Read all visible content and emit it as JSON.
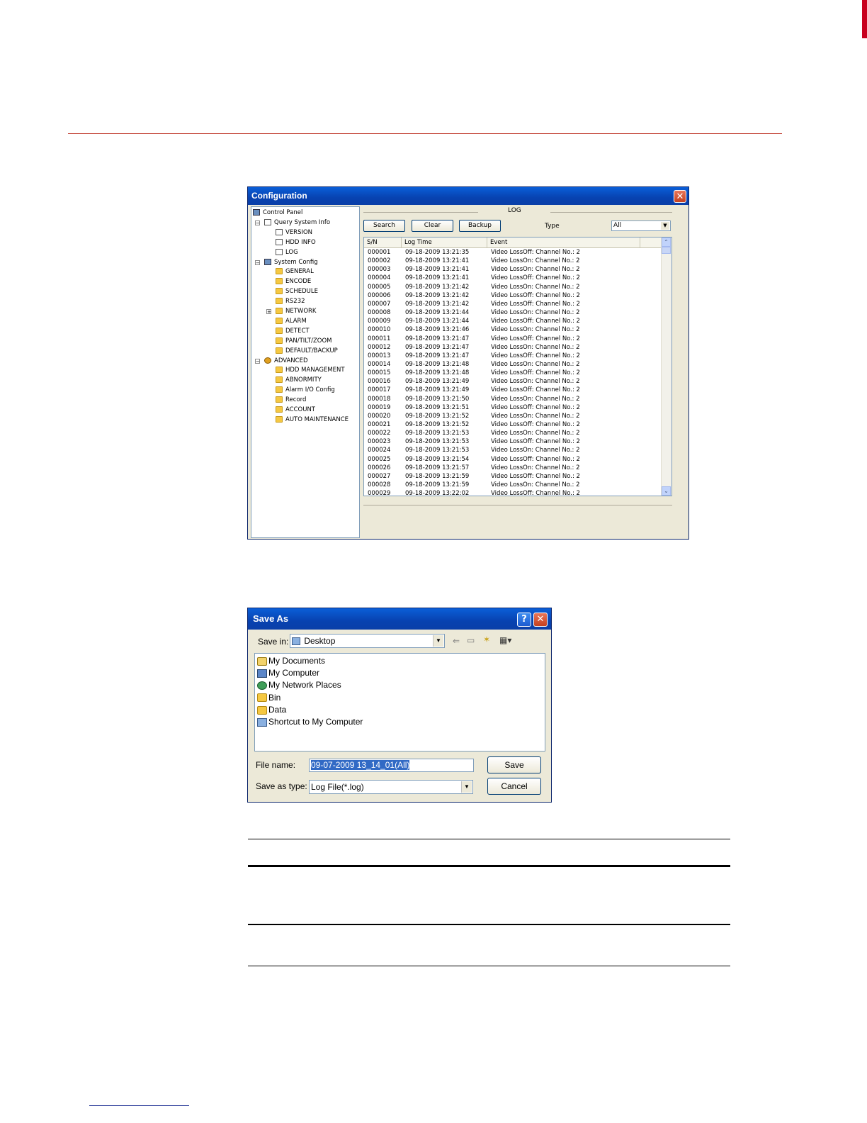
{
  "config_window": {
    "title": "Configuration",
    "close_glyph": "✕",
    "tree": [
      {
        "label": "Control Panel",
        "icon": "computer-icon",
        "level": 0,
        "expander": ""
      },
      {
        "label": "Query System Info",
        "icon": "document-icon",
        "level": 1,
        "expander": "−"
      },
      {
        "label": "VERSION",
        "icon": "document-icon",
        "level": 2,
        "expander": ""
      },
      {
        "label": "HDD INFO",
        "icon": "document-icon",
        "level": 2,
        "expander": ""
      },
      {
        "label": "LOG",
        "icon": "document-icon",
        "level": 2,
        "expander": ""
      },
      {
        "label": "System Config",
        "icon": "tools-icon",
        "level": 1,
        "expander": "−"
      },
      {
        "label": "GENERAL",
        "icon": "folder-icon",
        "level": 2,
        "expander": ""
      },
      {
        "label": "ENCODE",
        "icon": "folder-icon",
        "level": 2,
        "expander": ""
      },
      {
        "label": "SCHEDULE",
        "icon": "folder-icon",
        "level": 2,
        "expander": ""
      },
      {
        "label": "RS232",
        "icon": "folder-icon",
        "level": 2,
        "expander": ""
      },
      {
        "label": "NETWORK",
        "icon": "folder-icon",
        "level": 2,
        "expander": "+"
      },
      {
        "label": "ALARM",
        "icon": "folder-icon",
        "level": 2,
        "expander": ""
      },
      {
        "label": "DETECT",
        "icon": "folder-icon",
        "level": 2,
        "expander": ""
      },
      {
        "label": "PAN/TILT/ZOOM",
        "icon": "folder-icon",
        "level": 2,
        "expander": ""
      },
      {
        "label": "DEFAULT/BACKUP",
        "icon": "folder-icon",
        "level": 2,
        "expander": ""
      },
      {
        "label": "ADVANCED",
        "icon": "gear-icon",
        "level": 1,
        "expander": "−"
      },
      {
        "label": "HDD MANAGEMENT",
        "icon": "folder-icon",
        "level": 2,
        "expander": ""
      },
      {
        "label": "ABNORMITY",
        "icon": "folder-icon",
        "level": 2,
        "expander": ""
      },
      {
        "label": "Alarm I/O Config",
        "icon": "folder-icon",
        "level": 2,
        "expander": ""
      },
      {
        "label": "Record",
        "icon": "folder-icon",
        "level": 2,
        "expander": ""
      },
      {
        "label": "ACCOUNT",
        "icon": "folder-icon",
        "level": 2,
        "expander": ""
      },
      {
        "label": "AUTO MAINTENANCE",
        "icon": "folder-icon",
        "level": 2,
        "expander": ""
      }
    ],
    "log": {
      "group_label": "LOG",
      "search_label": "Search",
      "clear_label": "Clear",
      "backup_label": "Backup",
      "type_label": "Type",
      "type_value": "All",
      "columns": [
        "S/N",
        "Log Time",
        "Event"
      ],
      "rows": [
        [
          "000001",
          "09-18-2009 13:21:35",
          "Video LossOff: Channel No.: 2"
        ],
        [
          "000002",
          "09-18-2009 13:21:41",
          "Video LossOn: Channel No.: 2"
        ],
        [
          "000003",
          "09-18-2009 13:21:41",
          "Video LossOn: Channel No.: 2"
        ],
        [
          "000004",
          "09-18-2009 13:21:41",
          "Video LossOff: Channel No.: 2"
        ],
        [
          "000005",
          "09-18-2009 13:21:42",
          "Video LossOn: Channel No.: 2"
        ],
        [
          "000006",
          "09-18-2009 13:21:42",
          "Video LossOff: Channel No.: 2"
        ],
        [
          "000007",
          "09-18-2009 13:21:42",
          "Video LossOff: Channel No.: 2"
        ],
        [
          "000008",
          "09-18-2009 13:21:44",
          "Video LossOn: Channel No.: 2"
        ],
        [
          "000009",
          "09-18-2009 13:21:44",
          "Video LossOff: Channel No.: 2"
        ],
        [
          "000010",
          "09-18-2009 13:21:46",
          "Video LossOn: Channel No.: 2"
        ],
        [
          "000011",
          "09-18-2009 13:21:47",
          "Video LossOff: Channel No.: 2"
        ],
        [
          "000012",
          "09-18-2009 13:21:47",
          "Video LossOn: Channel No.: 2"
        ],
        [
          "000013",
          "09-18-2009 13:21:47",
          "Video LossOff: Channel No.: 2"
        ],
        [
          "000014",
          "09-18-2009 13:21:48",
          "Video LossOn: Channel No.: 2"
        ],
        [
          "000015",
          "09-18-2009 13:21:48",
          "Video LossOff: Channel No.: 2"
        ],
        [
          "000016",
          "09-18-2009 13:21:49",
          "Video LossOn: Channel No.: 2"
        ],
        [
          "000017",
          "09-18-2009 13:21:49",
          "Video LossOff: Channel No.: 2"
        ],
        [
          "000018",
          "09-18-2009 13:21:50",
          "Video LossOn: Channel No.: 2"
        ],
        [
          "000019",
          "09-18-2009 13:21:51",
          "Video LossOff: Channel No.: 2"
        ],
        [
          "000020",
          "09-18-2009 13:21:52",
          "Video LossOn: Channel No.: 2"
        ],
        [
          "000021",
          "09-18-2009 13:21:52",
          "Video LossOff: Channel No.: 2"
        ],
        [
          "000022",
          "09-18-2009 13:21:53",
          "Video LossOn: Channel No.: 2"
        ],
        [
          "000023",
          "09-18-2009 13:21:53",
          "Video LossOff: Channel No.: 2"
        ],
        [
          "000024",
          "09-18-2009 13:21:53",
          "Video LossOn: Channel No.: 2"
        ],
        [
          "000025",
          "09-18-2009 13:21:54",
          "Video LossOff: Channel No.: 2"
        ],
        [
          "000026",
          "09-18-2009 13:21:57",
          "Video LossOn: Channel No.: 2"
        ],
        [
          "000027",
          "09-18-2009 13:21:59",
          "Video LossOff: Channel No.: 2"
        ],
        [
          "000028",
          "09-18-2009 13:21:59",
          "Video LossOn: Channel No.: 2"
        ],
        [
          "000029",
          "09-18-2009 13:22:02",
          "Video LossOff: Channel No.: 2"
        ]
      ]
    }
  },
  "save_as": {
    "title": "Save As",
    "help_glyph": "?",
    "close_glyph": "✕",
    "save_in_label": "Save in:",
    "save_in_value": "Desktop",
    "items": [
      {
        "label": "My Documents",
        "icon": "my-documents-icon"
      },
      {
        "label": "My Computer",
        "icon": "my-computer-icon"
      },
      {
        "label": "My Network Places",
        "icon": "network-places-icon"
      },
      {
        "label": "Bin",
        "icon": "folder-icon"
      },
      {
        "label": "Data",
        "icon": "folder-icon"
      },
      {
        "label": "Shortcut to My Computer",
        "icon": "shortcut-icon"
      }
    ],
    "file_name_label": "File name:",
    "file_name_value": "09-07-2009 13_14_01(All)",
    "save_as_type_label": "Save as type:",
    "save_as_type_value": "Log File(*.log)",
    "save_button": "Save",
    "cancel_button": "Cancel"
  },
  "colors": {
    "title_bar": "#0842b0",
    "accent_red": "#c0392b",
    "window_bg": "#ece9d8"
  }
}
